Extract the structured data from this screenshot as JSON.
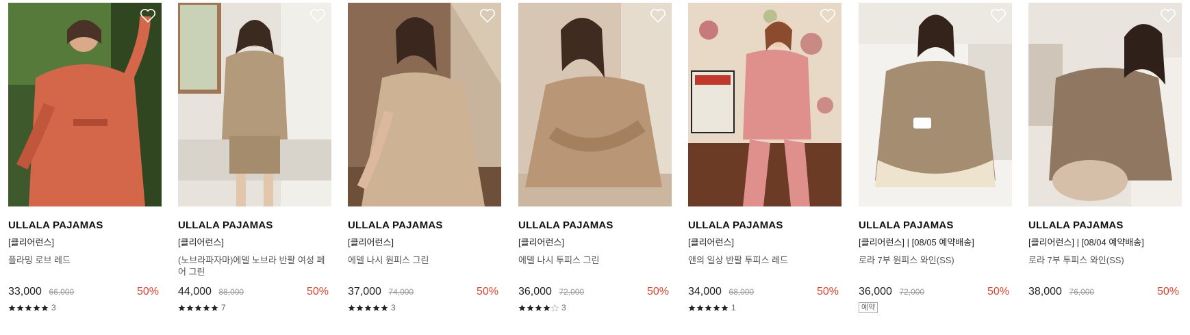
{
  "colors": {
    "discount": "#e2432b",
    "star": "#222222",
    "text": "#222222",
    "muted": "#999999"
  },
  "products": [
    {
      "brand": "ULLALA PAJAMAS",
      "tag": "[클리어런스]",
      "name": "플라밍 로브 레드",
      "price": "33,000",
      "original_price": "66,000",
      "discount": "50%",
      "rating": 5,
      "reviews": "3",
      "badge": "",
      "image": "woman in red floral robe outdoors among green leaves"
    },
    {
      "brand": "ULLALA PAJAMAS",
      "tag": "[클리어런스]",
      "name": "(노브라파자마)에델 노브라 반팔 여성 페어 그린",
      "price": "44,000",
      "original_price": "88,000",
      "discount": "50%",
      "rating": 5,
      "reviews": "7",
      "badge": "",
      "image": "woman in beige short-sleeve shirt and shorts pajama set"
    },
    {
      "brand": "ULLALA PAJAMAS",
      "tag": "[클리어런스]",
      "name": "에델 나시 원피스 그린",
      "price": "37,000",
      "original_price": "74,000",
      "discount": "50%",
      "rating": 5,
      "reviews": "3",
      "badge": "",
      "image": "woman in floral sleeveless dress sitting by window"
    },
    {
      "brand": "ULLALA PAJAMAS",
      "tag": "[클리어런스]",
      "name": "에델 나시 투피스 그린",
      "price": "36,000",
      "original_price": "72,000",
      "discount": "50%",
      "rating": 4,
      "reviews": "3",
      "badge": "",
      "image": "woman in floral sleeveless two-piece sitting"
    },
    {
      "brand": "ULLALA PAJAMAS",
      "tag": "[클리어런스]",
      "name": "앤의 일상 반팔 투피스 레드",
      "price": "34,000",
      "original_price": "68,000",
      "discount": "50%",
      "rating": 5,
      "reviews": "1",
      "badge": "",
      "image": "woman in pink two-piece with ruffle collar on wooden cabinet"
    },
    {
      "brand": "ULLALA PAJAMAS",
      "tag": "[클리어런스] | [08/05 예약배송]",
      "name": "로라 7부 원피스 와인(SS)",
      "price": "36,000",
      "original_price": "72,000",
      "discount": "50%",
      "rating": 0,
      "reviews": "",
      "badge": "예약",
      "image": "woman in floral ruffle nightgown sitting on bed holding cup"
    },
    {
      "brand": "ULLALA PAJAMAS",
      "tag": "[클리어런스] | [08/04 예약배송]",
      "name": "로라 7부 투피스 와인(SS)",
      "price": "38,000",
      "original_price": "76,000",
      "discount": "50%",
      "rating": 0,
      "reviews": "",
      "badge": "",
      "image": "woman in floral ruffle two-piece reclining on bed"
    }
  ]
}
